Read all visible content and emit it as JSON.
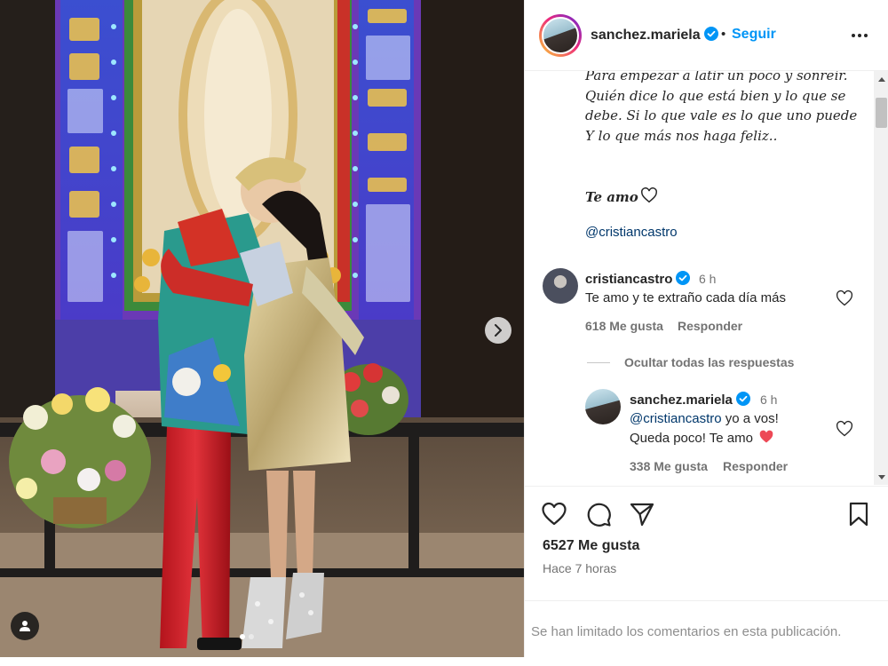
{
  "post": {
    "username": "sanchez.mariela",
    "separator": "•",
    "follow_label": "Seguir",
    "caption": "Para empezar a latir un poco y sonreír. Quién dice lo que está bien y lo que se debe. Si lo que vale es lo que uno puede\nY lo que más nos haga feliz..",
    "caption_end": "Te amo",
    "mention": "@cristiancastro"
  },
  "comments": [
    {
      "username": "cristiancastro",
      "time": "6 h",
      "text": "Te amo y te extraño cada día más",
      "likes": "618 Me gusta",
      "reply_label": "Responder"
    }
  ],
  "hide_replies_label": "Ocultar todas las respuestas",
  "replies": [
    {
      "username": "sanchez.mariela",
      "time": "6 h",
      "mention": "@cristiancastro",
      "text_after_mention": " yo a vos!",
      "text_line2": "Queda poco! Te amo",
      "likes": "338 Me gusta",
      "reply_label": "Responder"
    }
  ],
  "footer": {
    "likes": "6527 Me gusta",
    "time_ago": "Hace 7 horas",
    "comments_limited": "Se han limitado los comentarios en esta publicación."
  },
  "colors": {
    "link": "#0095f6",
    "mention": "#00376b",
    "verified": "#0095f6",
    "heart_red": "#ed4956"
  },
  "icons": {
    "like": "heart-icon",
    "comment": "comment-icon",
    "share": "send-icon",
    "save": "bookmark-icon",
    "more": "more-options-icon",
    "next": "chevron-right-icon",
    "tags": "user-tag-icon"
  }
}
